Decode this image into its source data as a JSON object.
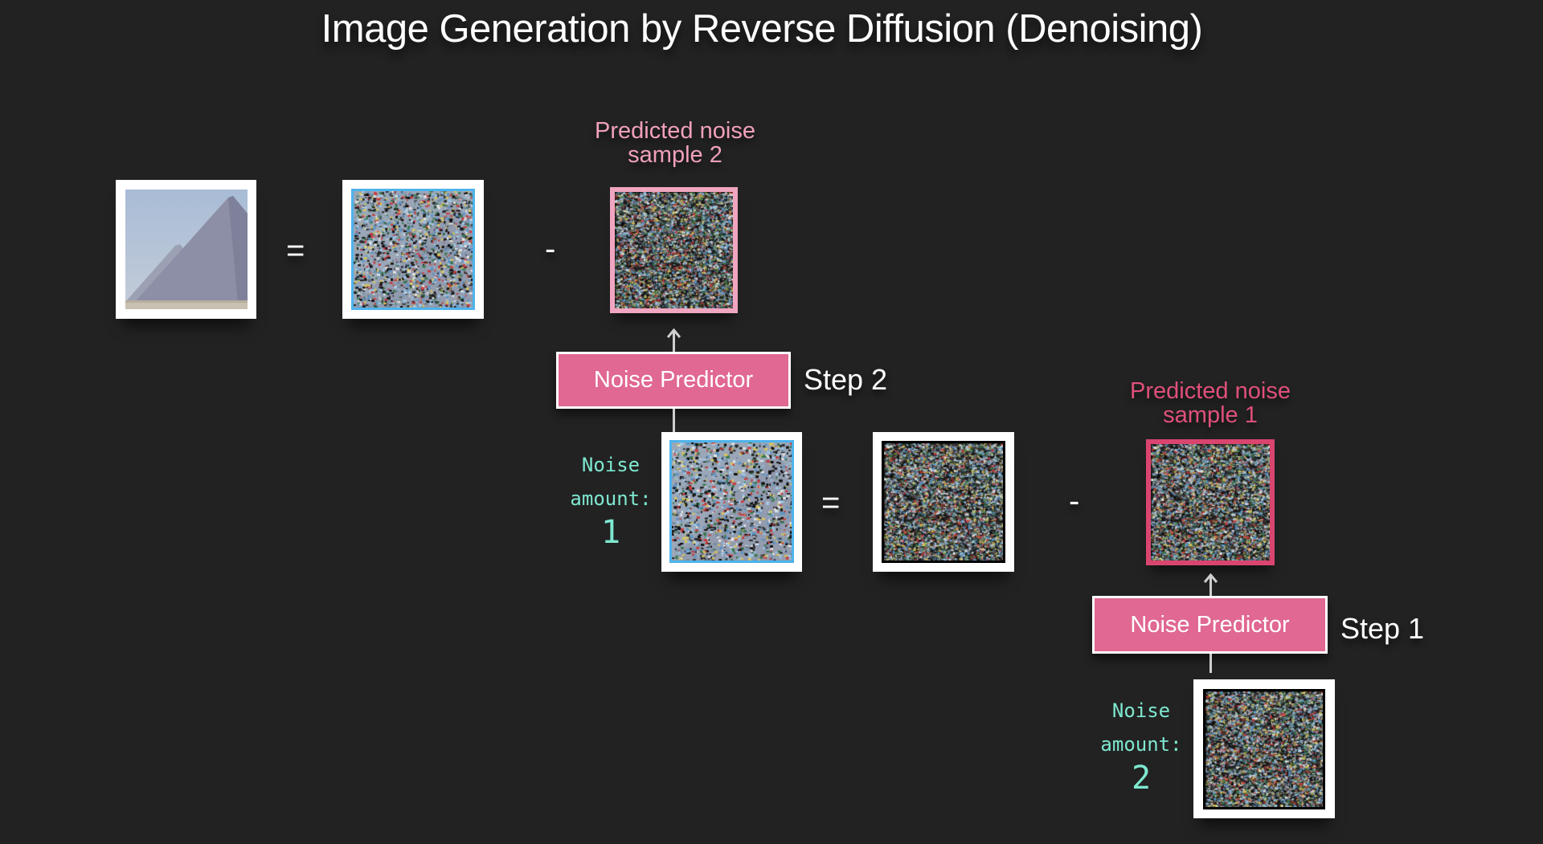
{
  "title": "Image Generation by Reverse Diffusion (Denoising)",
  "colors": {
    "background": "#222222",
    "noise_predictor_fill": "#e06892",
    "predicted_noise_2_label": "#f0a0bc",
    "predicted_noise_1_label": "#e0507a",
    "predicted_noise_2_border": "#f0a6c0",
    "predicted_noise_1_border": "#d9456f",
    "noisy_image_border": "#4eb3ec",
    "pure_noise_border": "#000000",
    "noise_amount_text": "#7ee8d0"
  },
  "row_top": {
    "result_image": "pyramid-image",
    "equals": "=",
    "noisy_image": "noisy-pyramid-image",
    "minus": "-",
    "predicted_noise_label": "Predicted noise sample 2",
    "predicted_noise_label_line1": "Predicted noise",
    "predicted_noise_label_line2": "sample 2"
  },
  "step2": {
    "predictor_label": "Noise Predictor",
    "step_label": "Step 2",
    "noise_amount_line1": "Noise",
    "noise_amount_line2": "amount:",
    "noise_amount_value": "1",
    "equals": "=",
    "minus": "-",
    "predicted_noise_label_line1": "Predicted noise",
    "predicted_noise_label_line2": "sample 1"
  },
  "step1": {
    "predictor_label": "Noise Predictor",
    "step_label": "Step 1",
    "noise_amount_line1": "Noise",
    "noise_amount_line2": "amount:",
    "noise_amount_value": "2"
  }
}
